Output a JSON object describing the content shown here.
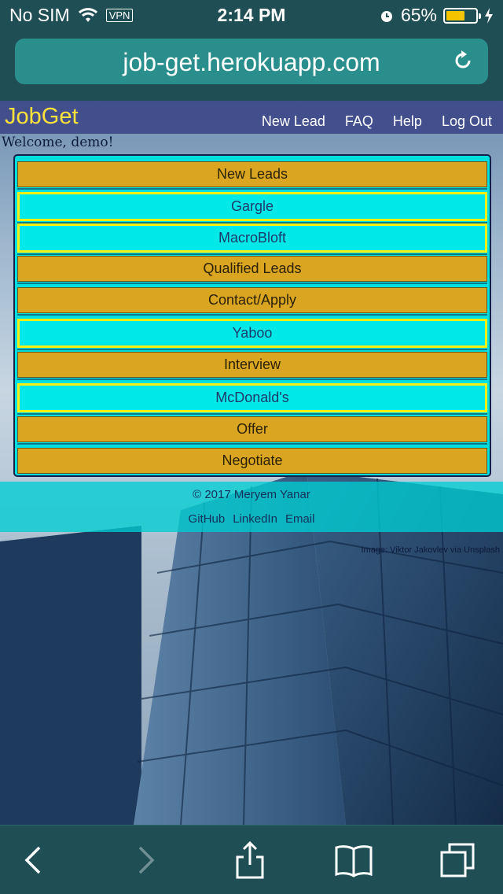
{
  "status_bar": {
    "carrier": "No SIM",
    "vpn": "VPN",
    "time": "2:14 PM",
    "battery": "65%",
    "battery_level": 0.65
  },
  "browser": {
    "url": "job-get.herokuapp.com"
  },
  "app": {
    "brand": "JobGet",
    "nav": [
      "New Lead",
      "FAQ",
      "Help",
      "Log Out"
    ],
    "welcome": "Welcome, demo!"
  },
  "board": {
    "rows": [
      {
        "type": "stage",
        "label": "New Leads"
      },
      {
        "type": "lead",
        "label": "Gargle"
      },
      {
        "type": "lead",
        "label": "MacroBloft"
      },
      {
        "type": "stage",
        "label": "Qualified Leads"
      },
      {
        "type": "stage",
        "label": "Contact/Apply"
      },
      {
        "type": "lead",
        "label": "Yaboo"
      },
      {
        "type": "stage",
        "label": "Interview"
      },
      {
        "type": "lead",
        "label": "McDonald's"
      },
      {
        "type": "stage",
        "label": "Offer"
      },
      {
        "type": "stage",
        "label": "Negotiate"
      }
    ],
    "stage_color": "#daa520",
    "lead_color": "#00e8e8",
    "lead_border_color": "#f7f012"
  },
  "footer": {
    "copyright": "© 2017 Meryem Yanar",
    "links": [
      "GitHub",
      "LinkedIn",
      "Email"
    ],
    "image_credit": "Image: Viktor Jakovlev via Unsplash"
  },
  "toolbar": {
    "icons": [
      "back-icon",
      "forward-icon",
      "share-icon",
      "bookmarks-icon",
      "tabs-icon"
    ]
  }
}
